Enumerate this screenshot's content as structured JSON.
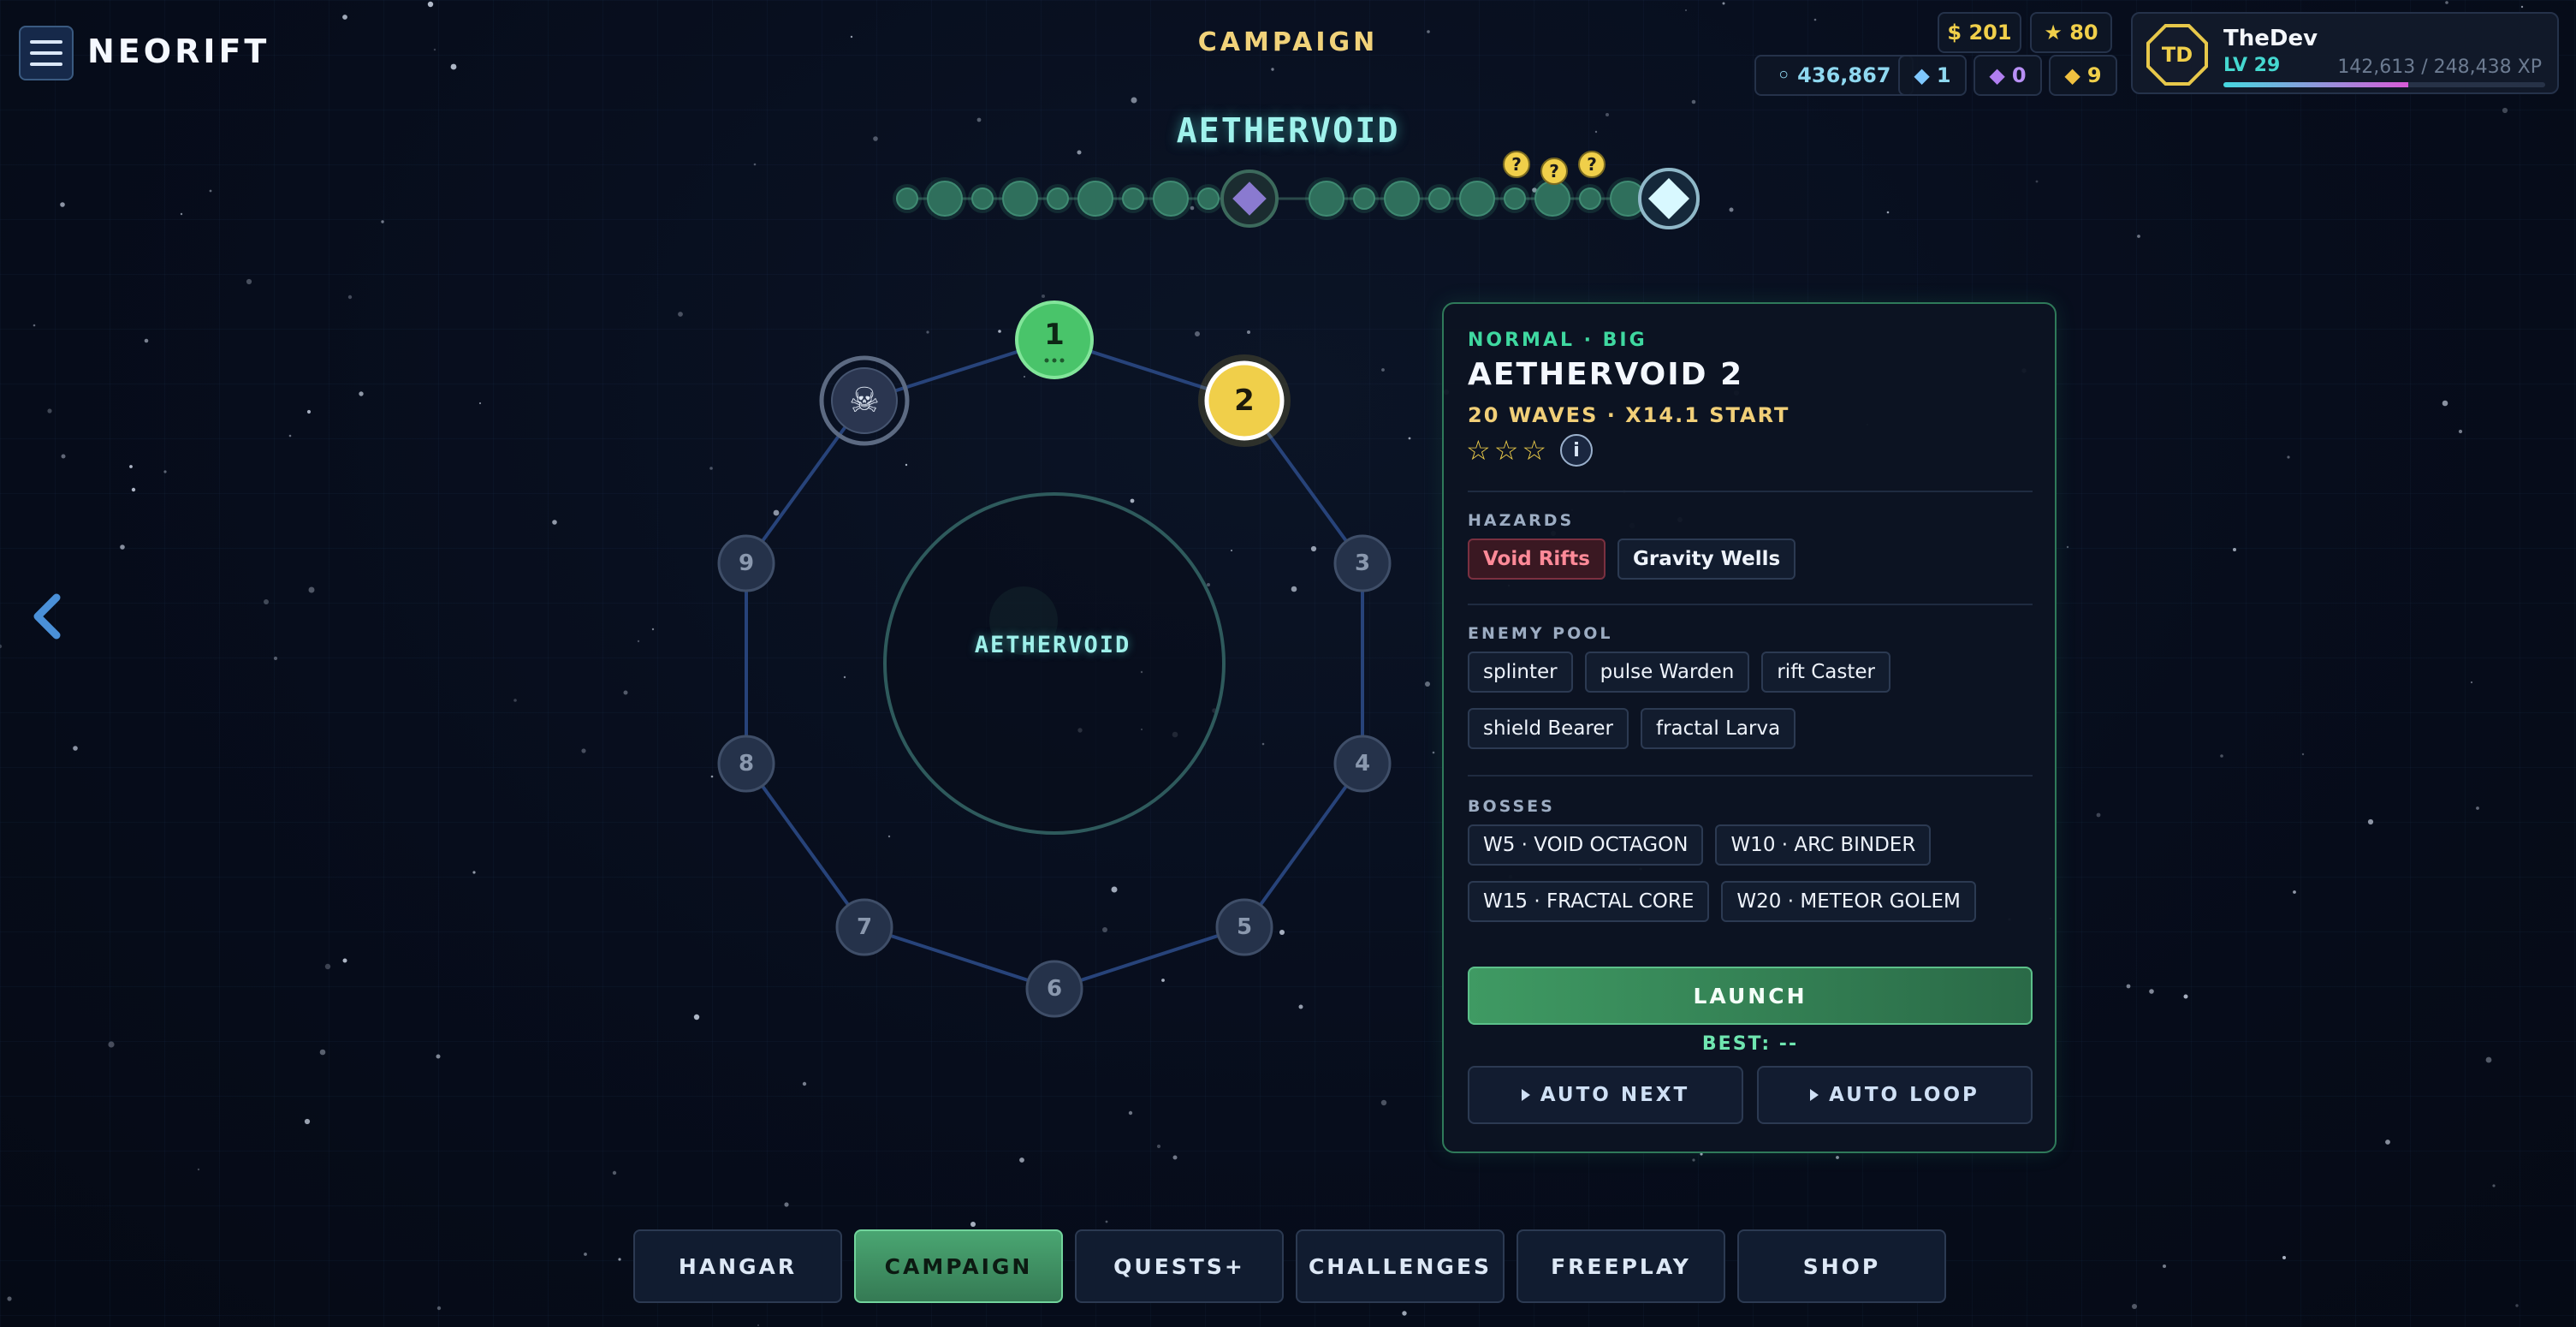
{
  "header": {
    "brand": "NEORIFT",
    "title": "CAMPAIGN",
    "currencies": {
      "cash": "$ 201",
      "stars": "★ 80",
      "orbs": "◦ 436,867",
      "blue_gems": "1",
      "purple_gems": "0",
      "gold_gems": "9"
    },
    "profile": {
      "initials": "TD",
      "name": "TheDev",
      "level": "LV 29",
      "xp": "142,613 / 248,438 XP",
      "xp_progress": 0.574
    }
  },
  "world": {
    "name": "AETHERVOID",
    "center_label": "AETHERVOID",
    "progress_marker": "?"
  },
  "stages": [
    {
      "label": "1",
      "state": "cleared"
    },
    {
      "label": "2",
      "state": "selected"
    },
    {
      "label": "3",
      "state": "locked"
    },
    {
      "label": "4",
      "state": "locked"
    },
    {
      "label": "5",
      "state": "locked"
    },
    {
      "label": "6",
      "state": "locked"
    },
    {
      "label": "7",
      "state": "locked"
    },
    {
      "label": "8",
      "state": "locked"
    },
    {
      "label": "9",
      "state": "locked"
    },
    {
      "label": "☠",
      "state": "boss"
    }
  ],
  "panel": {
    "mode": "NORMAL · BIG",
    "title": "AETHERVOID 2",
    "subtitle": "20 WAVES · X14.1 START",
    "stars": [
      "☆",
      "☆",
      "☆"
    ],
    "info": "i",
    "hazards_heading": "HAZARDS",
    "hazards": [
      {
        "label": "Void Rifts",
        "tone": "red"
      },
      {
        "label": "Gravity Wells",
        "tone": "neutral"
      }
    ],
    "enemy_heading": "ENEMY POOL",
    "enemies": [
      "splinter",
      "pulse Warden",
      "rift Caster",
      "shield Bearer",
      "fractal Larva"
    ],
    "bosses_heading": "BOSSES",
    "bosses": [
      "W5 · VOID OCTAGON",
      "W10 · ARC BINDER",
      "W15 · FRACTAL CORE",
      "W20 · METEOR GOLEM"
    ],
    "launch": "LAUNCH",
    "best": "BEST: --",
    "auto_next": "AUTO NEXT",
    "auto_loop": "AUTO LOOP"
  },
  "nav": [
    "HANGAR",
    "CAMPAIGN",
    "QUESTS+",
    "CHALLENGES",
    "FREEPLAY",
    "SHOP"
  ],
  "nav_active": "CAMPAIGN",
  "colors": {
    "accent_green": "#3fd8a0",
    "selected_yellow": "#f0cf4a",
    "cyan": "#9ff2ec",
    "hazard_red": "#ff8a98"
  }
}
